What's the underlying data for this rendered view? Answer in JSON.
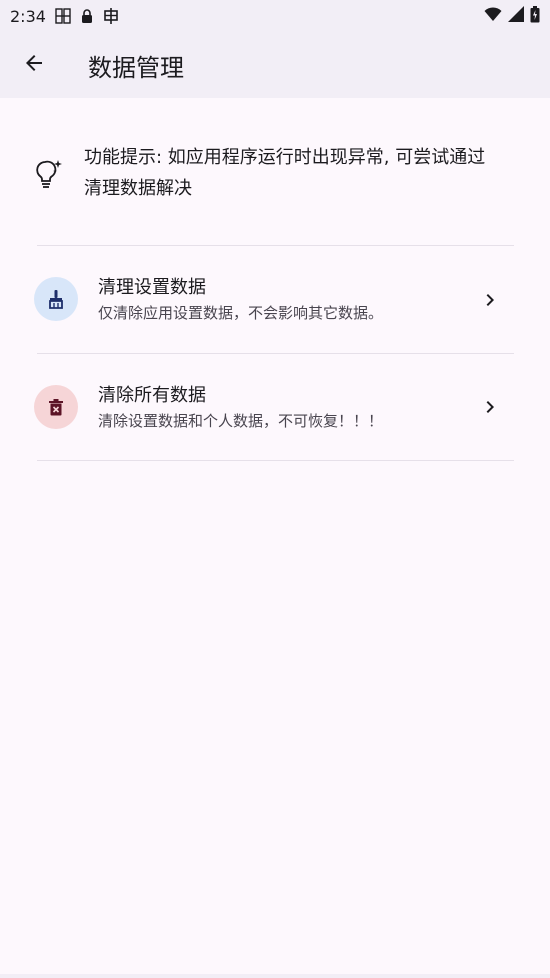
{
  "status_bar": {
    "time": "2:34",
    "icons": [
      "notification-icon",
      "lock-icon",
      "debug-icon",
      "wifi-icon",
      "signal-icon",
      "battery-icon"
    ]
  },
  "app_bar": {
    "title": "数据管理",
    "back_icon": "arrow-back-icon"
  },
  "tip": {
    "icon": "lightbulb-icon",
    "text": "功能提示: 如应用程序运行时出现异常, 可尝试通过清理数据解决"
  },
  "items": [
    {
      "title": "清理设置数据",
      "subtitle": "仅清除应用设置数据，不会影响其它数据。",
      "icon": "broom-icon",
      "icon_bg": "#d8e6f9",
      "icon_color": "#1e2f6b"
    },
    {
      "title": "清除所有数据",
      "subtitle": "清除设置数据和个人数据，不可恢复！！！",
      "icon": "delete-icon",
      "icon_bg": "#f6d5d7",
      "icon_color": "#5c1426"
    }
  ],
  "colors": {
    "background": "#fdf8fd",
    "app_bar": "#f2eef6",
    "divider": "#e6e0e9"
  }
}
